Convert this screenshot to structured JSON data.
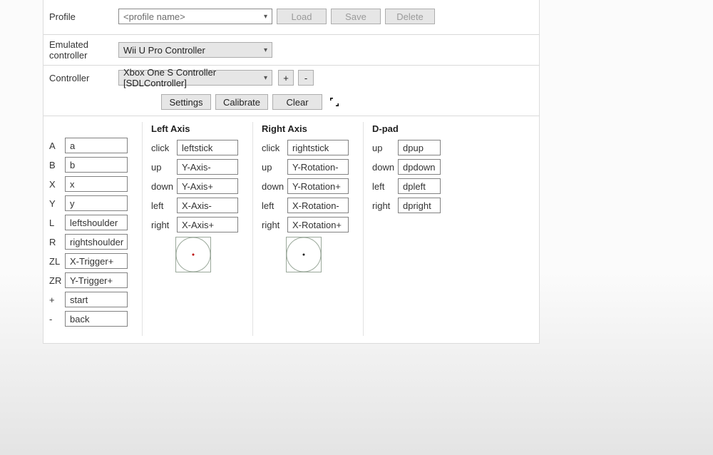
{
  "profile": {
    "label": "Profile",
    "placeholder": "<profile name>",
    "buttons": {
      "load": "Load",
      "save": "Save",
      "delete": "Delete"
    }
  },
  "emulated": {
    "label": "Emulated controller",
    "value": "Wii U Pro Controller"
  },
  "controller": {
    "label": "Controller",
    "value": "Xbox One S Controller [SDLController]",
    "add": "+",
    "remove": "-"
  },
  "toolbar": {
    "settings": "Settings",
    "calibrate": "Calibrate",
    "clear": "Clear"
  },
  "columns": {
    "buttons": [
      {
        "label": "A",
        "value": "a"
      },
      {
        "label": "B",
        "value": "b"
      },
      {
        "label": "X",
        "value": "x"
      },
      {
        "label": "Y",
        "value": "y"
      },
      {
        "label": "L",
        "value": "leftshoulder"
      },
      {
        "label": "R",
        "value": "rightshoulder"
      },
      {
        "label": "ZL",
        "value": "X-Trigger+"
      },
      {
        "label": "ZR",
        "value": "Y-Trigger+"
      },
      {
        "label": "+",
        "value": "start"
      },
      {
        "label": "-",
        "value": "back"
      }
    ],
    "left_axis": {
      "title": "Left Axis",
      "rows": [
        {
          "label": "click",
          "value": "leftstick"
        },
        {
          "label": "up",
          "value": "Y-Axis-"
        },
        {
          "label": "down",
          "value": "Y-Axis+"
        },
        {
          "label": "left",
          "value": "X-Axis-"
        },
        {
          "label": "right",
          "value": "X-Axis+"
        }
      ]
    },
    "right_axis": {
      "title": "Right Axis",
      "rows": [
        {
          "label": "click",
          "value": "rightstick"
        },
        {
          "label": "up",
          "value": "Y-Rotation-"
        },
        {
          "label": "down",
          "value": "Y-Rotation+"
        },
        {
          "label": "left",
          "value": "X-Rotation-"
        },
        {
          "label": "right",
          "value": "X-Rotation+"
        }
      ]
    },
    "dpad": {
      "title": "D-pad",
      "rows": [
        {
          "label": "up",
          "value": "dpup"
        },
        {
          "label": "down",
          "value": "dpdown"
        },
        {
          "label": "left",
          "value": "dpleft"
        },
        {
          "label": "right",
          "value": "dpright"
        }
      ]
    }
  }
}
